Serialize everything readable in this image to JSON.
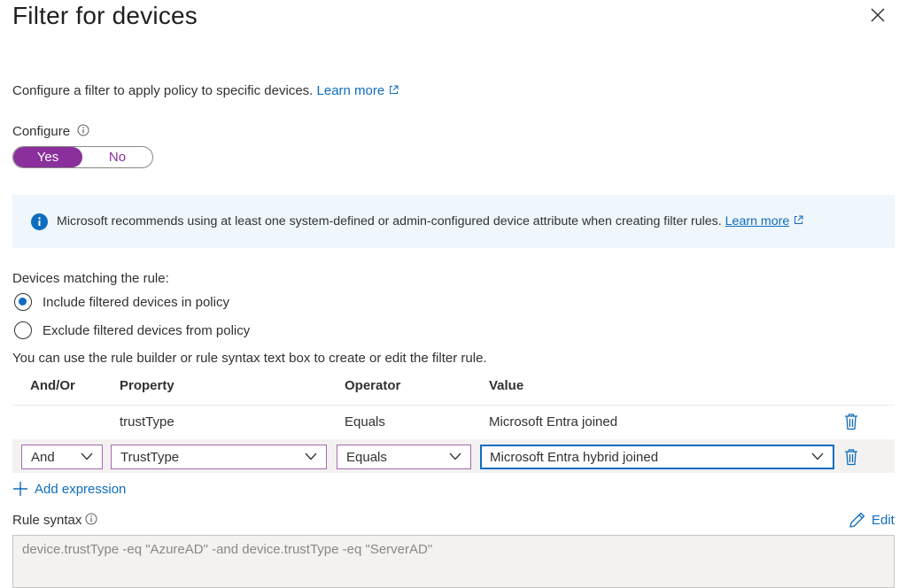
{
  "panel": {
    "title": "Filter for devices"
  },
  "intro": {
    "text": "Configure a filter to apply policy to specific devices.",
    "link": "Learn more"
  },
  "configure": {
    "label": "Configure",
    "yes": "Yes",
    "no": "No",
    "selected": "Yes"
  },
  "banner": {
    "text": "Microsoft recommends using at least one system-defined or admin-configured device attribute when creating filter rules.",
    "link": "Learn more"
  },
  "matching": {
    "label": "Devices matching the rule:",
    "include": "Include filtered devices in policy",
    "exclude": "Exclude filtered devices from policy",
    "selected": "include"
  },
  "builder_hint": "You can use the rule builder or rule syntax text box to create or edit the filter rule.",
  "table": {
    "headers": {
      "andor": "And/Or",
      "property": "Property",
      "operator": "Operator",
      "value": "Value"
    },
    "rows": [
      {
        "andor": "",
        "property": "trustType",
        "operator": "Equals",
        "value": "Microsoft Entra joined"
      },
      {
        "andor": "And",
        "property": "TrustType",
        "operator": "Equals",
        "value": "Microsoft Entra hybrid joined"
      }
    ]
  },
  "add_expression": "Add expression",
  "rule_syntax": {
    "label": "Rule syntax",
    "edit": "Edit",
    "value": "device.trustType -eq \"AzureAD\" -and device.trustType -eq \"ServerAD\""
  },
  "colors": {
    "accent": "#8a2f9b",
    "link": "#0f6cbd",
    "banner_bg": "#eff6fc"
  },
  "icons": [
    "close-icon",
    "external-link-icon",
    "info-icon",
    "delete-icon",
    "chevron-down-icon",
    "plus-icon",
    "pencil-icon"
  ]
}
